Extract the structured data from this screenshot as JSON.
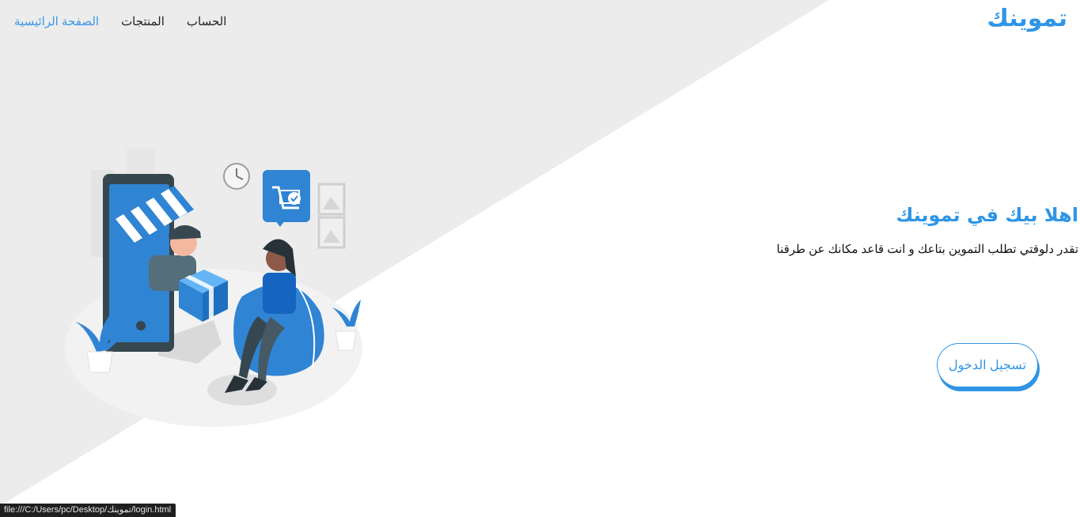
{
  "brand": {
    "name": "تموينك"
  },
  "nav": {
    "items": [
      {
        "label": "الصفحة الرائيسية",
        "active": true
      },
      {
        "label": "المنتجات",
        "active": false
      },
      {
        "label": "الحساب",
        "active": false
      }
    ]
  },
  "hero": {
    "title": "اهلا بيك في تموينك",
    "subtitle": "تقدر دلوقتي تطلب التموين بتاعك و انت قاعد مكانك عن طرقنا",
    "login_label": "تسجيل الدخول"
  },
  "status_bar": {
    "url": "file:///C:/Users/pc/Desktop/تموينك/login.html"
  },
  "colors": {
    "accent": "#2f95e6",
    "diagonal_bg": "#ececec",
    "text": "#111111",
    "status_bg": "#1f1f1f"
  },
  "icons": [
    "shopping-cart-icon",
    "clock-icon",
    "picture-frame-icon",
    "gift-box-icon",
    "storefront-awning-icon",
    "plant-icon"
  ]
}
